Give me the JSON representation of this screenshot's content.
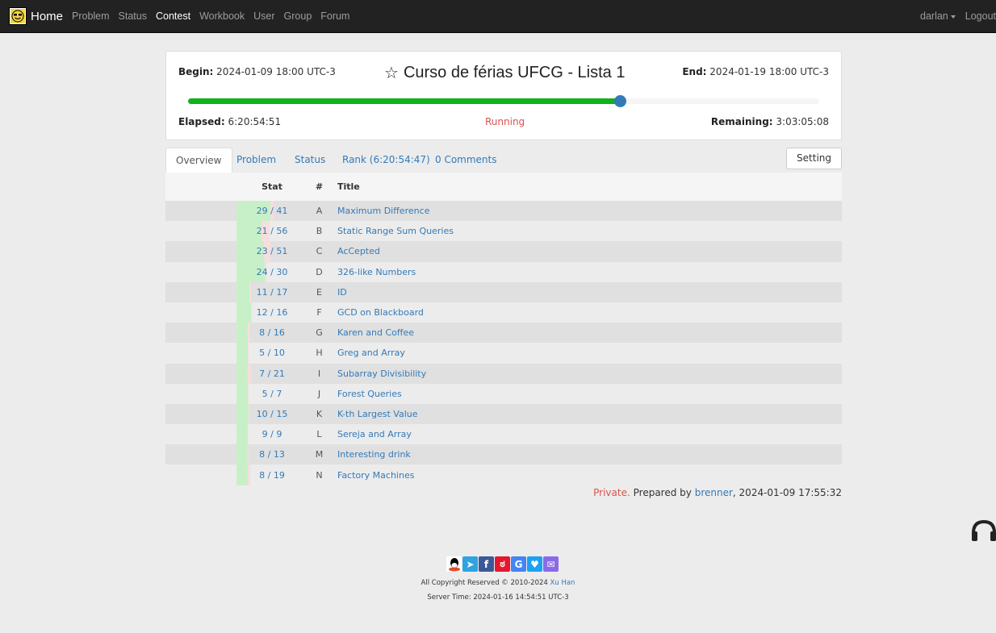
{
  "navbar": {
    "brand": "Home",
    "links": [
      "Problem",
      "Status",
      "Contest",
      "Workbook",
      "User",
      "Group",
      "Forum"
    ],
    "active": "Contest",
    "user": "darlan",
    "logout": "Logout"
  },
  "contest": {
    "begin_label": "Begin:",
    "begin": "2024-01-09 18:00 UTC-3",
    "end_label": "End:",
    "end": "2024-01-19 18:00 UTC-3",
    "title": "Curso de férias UFCG - Lista 1",
    "elapsed_label": "Elapsed:",
    "elapsed": "6:20:54:51",
    "status": "Running",
    "remaining_label": "Remaining:",
    "remaining": "3:03:05:08",
    "progress": 0.686
  },
  "tabs": {
    "overview": "Overview",
    "problem": "Problem",
    "status": "Status",
    "rank": "Rank (6:20:54:47)",
    "comments": "0 Comments",
    "setting": "Setting"
  },
  "table": {
    "headers": {
      "stat": "Stat",
      "num": "#",
      "title": "Title"
    },
    "rows": [
      {
        "stat": "29 / 41",
        "num": "A",
        "title": "Maximum Difference",
        "solved": 29,
        "tried": 41
      },
      {
        "stat": "21 / 56",
        "num": "B",
        "title": "Static Range Sum Queries",
        "solved": 21,
        "tried": 56
      },
      {
        "stat": "23 / 51",
        "num": "C",
        "title": "AcCepted",
        "solved": 23,
        "tried": 51
      },
      {
        "stat": "24 / 30",
        "num": "D",
        "title": "326-like Numbers",
        "solved": 24,
        "tried": 30
      },
      {
        "stat": "11 / 17",
        "num": "E",
        "title": "ID",
        "solved": 11,
        "tried": 17
      },
      {
        "stat": "12 / 16",
        "num": "F",
        "title": "GCD on Blackboard",
        "solved": 12,
        "tried": 16
      },
      {
        "stat": "8 / 16",
        "num": "G",
        "title": "Karen and Coffee",
        "solved": 8,
        "tried": 16
      },
      {
        "stat": "5 / 10",
        "num": "H",
        "title": "Greg and Array",
        "solved": 5,
        "tried": 10
      },
      {
        "stat": "7 / 21",
        "num": "I",
        "title": "Subarray Divisibility",
        "solved": 7,
        "tried": 21
      },
      {
        "stat": "5 / 7",
        "num": "J",
        "title": "Forest Queries",
        "solved": 5,
        "tried": 7
      },
      {
        "stat": "10 / 15",
        "num": "K",
        "title": "K-th Largest Value",
        "solved": 10,
        "tried": 15
      },
      {
        "stat": "9 / 9",
        "num": "L",
        "title": "Sereja and Array",
        "solved": 9,
        "tried": 9
      },
      {
        "stat": "8 / 13",
        "num": "M",
        "title": "Interesting drink",
        "solved": 8,
        "tried": 13
      },
      {
        "stat": "8 / 19",
        "num": "N",
        "title": "Factory Machines",
        "solved": 8,
        "tried": 19
      }
    ]
  },
  "note": {
    "private": "Private.",
    "prepared_by": "Prepared by",
    "author": "brenner",
    "timestamp": ", 2024-01-09 17:55:32"
  },
  "footer": {
    "copyright_prefix": "All Copyright Reserved © 2010-2024",
    "copyright_name": "Xu Han",
    "server_time": "Server Time: 2024-01-16 14:54:51 UTC-3",
    "share_icons": [
      "qq-icon",
      "telegram-icon",
      "facebook-icon",
      "weibo-icon",
      "google-icon",
      "twitter-icon",
      "email-icon"
    ]
  },
  "colors": {
    "accepted": "#c8f0c8",
    "wrong": "#f6dede",
    "progress": "#11b11b",
    "link": "#337ab7",
    "running": "#d9534f"
  }
}
